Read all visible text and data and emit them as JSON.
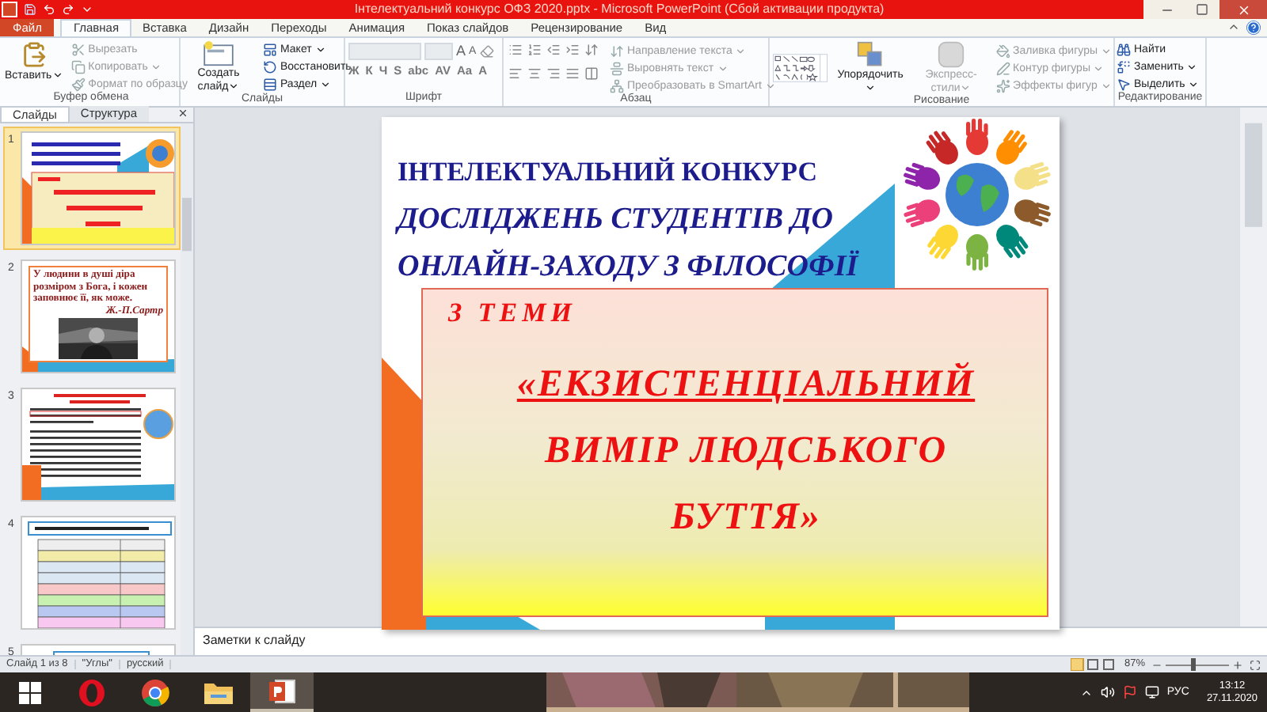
{
  "window": {
    "title": "Інтелектуальний конкурс ОФЗ 2020.pptx - Microsoft PowerPoint (Сбой активации продукта)"
  },
  "ribbon_tabs": [
    {
      "label": "Файл",
      "kind": "file",
      "selected": false
    },
    {
      "label": "Главная",
      "kind": "tab",
      "selected": true
    },
    {
      "label": "Вставка",
      "kind": "tab",
      "selected": false
    },
    {
      "label": "Дизайн",
      "kind": "tab",
      "selected": false
    },
    {
      "label": "Переходы",
      "kind": "tab",
      "selected": false
    },
    {
      "label": "Анимация",
      "kind": "tab",
      "selected": false
    },
    {
      "label": "Показ слайдов",
      "kind": "tab",
      "selected": false
    },
    {
      "label": "Рецензирование",
      "kind": "tab",
      "selected": false
    },
    {
      "label": "Вид",
      "kind": "tab",
      "selected": false
    }
  ],
  "ribbon_groups": [
    {
      "kind": "clipboard",
      "label": "Буфер обмена",
      "large": [
        {
          "label": "Вставить",
          "disabled": false,
          "dropdown": true
        }
      ],
      "items": [
        {
          "label": "Вырезать",
          "disabled": true,
          "dropdown": false
        },
        {
          "label": "Копировать",
          "disabled": true,
          "dropdown": true
        },
        {
          "label": "Формат по образцу",
          "disabled": true,
          "dropdown": false
        }
      ]
    },
    {
      "kind": "slides",
      "label": "Слайды",
      "large": [
        {
          "label": "Создать слайд",
          "disabled": false,
          "dropdown": true
        }
      ],
      "items": [
        {
          "label": "Макет",
          "disabled": false,
          "dropdown": true
        },
        {
          "label": "Восстановить",
          "disabled": false,
          "dropdown": false
        },
        {
          "label": "Раздел",
          "disabled": false,
          "dropdown": true
        }
      ]
    },
    {
      "kind": "font",
      "label": "Шрифт",
      "fields": [
        {
          "disabled": true
        },
        {
          "disabled": true
        }
      ],
      "size_buttons": [
        "A",
        "A"
      ],
      "buttons": [
        "Ж",
        "К",
        "Ч",
        "S",
        "abc",
        "AV",
        "Aa",
        "A"
      ]
    },
    {
      "kind": "paragraph",
      "label": "Абзац",
      "items": [
        {
          "label": "Направление текста",
          "disabled": true,
          "dropdown": true
        },
        {
          "label": "Выровнять текст",
          "disabled": true,
          "dropdown": true
        },
        {
          "label": "Преобразовать в SmartArt",
          "disabled": true,
          "dropdown": true
        }
      ]
    },
    {
      "kind": "drawing",
      "label": "Рисование",
      "large": [
        {
          "label": "Упорядочить",
          "disabled": false,
          "dropdown": true
        },
        {
          "label": "Экспресс-стили",
          "disabled": true,
          "dropdown": true
        }
      ],
      "items": [
        {
          "label": "Заливка фигуры",
          "disabled": true,
          "dropdown": true
        },
        {
          "label": "Контур фигуры",
          "disabled": true,
          "dropdown": true
        },
        {
          "label": "Эффекты фигур",
          "disabled": true,
          "dropdown": true
        }
      ]
    },
    {
      "kind": "editing",
      "label": "Редактирование",
      "items": [
        {
          "label": "Найти",
          "disabled": false,
          "dropdown": false
        },
        {
          "label": "Заменить",
          "disabled": false,
          "dropdown": true
        },
        {
          "label": "Выделить",
          "disabled": false,
          "dropdown": true
        }
      ]
    }
  ],
  "pane_tabs": [
    {
      "label": "Слайды",
      "selected": true
    },
    {
      "label": "Структура",
      "selected": false
    }
  ],
  "slides": [
    {
      "number": "1",
      "kind": "title",
      "selected": true
    },
    {
      "number": "2",
      "kind": "quote",
      "selected": false,
      "quote": "У людини в душі діра розміром з Бога, і кожен заповнює її, як може.",
      "author": "Ж.-П.Сартр"
    },
    {
      "number": "3",
      "kind": "text",
      "selected": false
    },
    {
      "number": "4",
      "kind": "table",
      "selected": false
    },
    {
      "number": "5",
      "kind": "cut",
      "selected": false
    }
  ],
  "slide": {
    "title_lines": [
      "ІНТЕЛЕКТУАЛЬНИЙ КОНКУРС",
      "ДОСЛІДЖЕНЬ СТУДЕНТІВ ДО",
      "ОНЛАЙН-ЗАХОДУ З ФІЛОСОФІЇ"
    ],
    "subtitle": "З ТЕМИ",
    "topic_lines": [
      "«ЕКЗИСТЕНЦІАЛЬНИЙ",
      "ВИМІР  ЛЮДСЬКОГО",
      "БУТТЯ»"
    ]
  },
  "notes": {
    "placeholder": "Заметки к слайду"
  },
  "status_bar": {
    "items": [
      "Слайд 1 из 8",
      "\"Углы\"",
      "русский"
    ],
    "zoom": "87%",
    "zoom_level": {
      "level": 0.42
    }
  },
  "taskbar": {
    "apps": [
      {
        "kind": "red-o",
        "selected": false
      },
      {
        "kind": "browser",
        "selected": false
      },
      {
        "kind": "folder",
        "selected": false
      },
      {
        "kind": "presentation",
        "selected": true
      }
    ],
    "language": "РУС",
    "time": "13:12",
    "date": "27.11.2020"
  }
}
